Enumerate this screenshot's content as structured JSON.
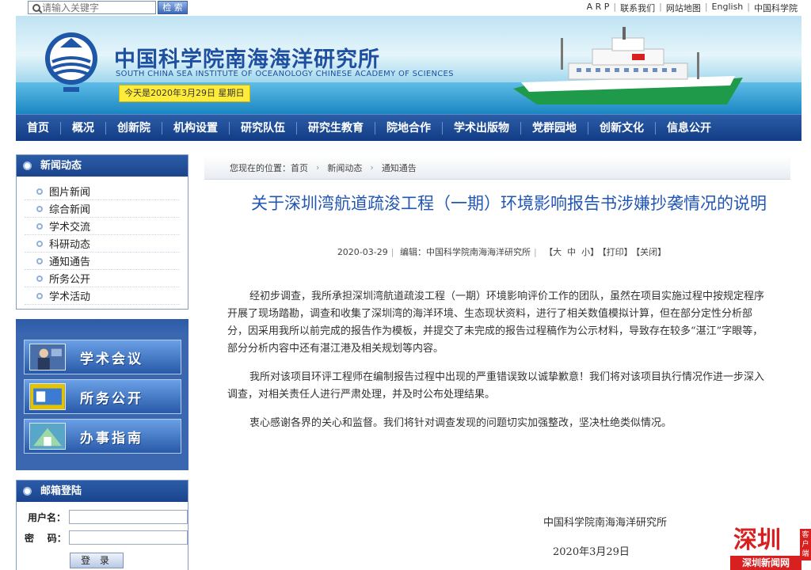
{
  "topbar": {
    "search_placeholder": "请输入关键字",
    "search_button": "检 索",
    "links": [
      "A R P",
      "联系我们",
      "网站地图",
      "English",
      "中国科学院"
    ]
  },
  "banner": {
    "title_cn": "中国科学院南海海洋研究所",
    "title_en": "SOUTH CHINA SEA INSTITUTE OF OCEANOLOGY  CHINESE ACADEMY OF SCIENCES",
    "date": "今天是2020年3月29日  星期日"
  },
  "nav": [
    "首页",
    "概况",
    "创新院",
    "机构设置",
    "研究队伍",
    "研究生教育",
    "院地合作",
    "学术出版物",
    "党群园地",
    "创新文化",
    "信息公开"
  ],
  "news": {
    "title": "新闻动态",
    "items": [
      "图片新闻",
      "综合新闻",
      "学术交流",
      "科研动态",
      "通知通告",
      "所务公开",
      "学术活动"
    ]
  },
  "quick": [
    "学术会议",
    "所务公开",
    "办事指南"
  ],
  "mail": {
    "title": "邮箱登陆",
    "user_label": "用户名：",
    "pass_label": "密    码：",
    "login": "登 录"
  },
  "breadcrumb": {
    "prefix": "您现在的位置：",
    "items": [
      "首页",
      "新闻动态",
      "通知通告"
    ]
  },
  "article": {
    "title": "关于深圳湾航道疏浚工程（一期）环境影响报告书涉嫌抄袭情况的说明",
    "date": "2020-03-29",
    "editor": "编辑：中国科学院南海海洋研究所",
    "font_options": "【大  中  小】",
    "print": "【打印】",
    "close": "【关闭】",
    "paragraphs": [
      "经初步调查，我所承担深圳湾航道疏浚工程（一期）环境影响评价工作的团队，虽然在项目实施过程中按规定程序开展了现场踏勘，调查和收集了深圳湾的海洋环境、生态现状资料，进行了相关数值模拟计算，但在部分定性分析部分，因采用我所以前完成的报告作为模板，并提交了未完成的报告过程稿作为公示材料，导致存在较多“湛江”字眼等，部分分析内容中还有湛江港及相关规划等内容。",
      "我所对该项目环评工程师在编制报告过程中出现的严重错误致以诚挚歉意！我们将对该项目执行情况作进一步深入调查，对相关责任人进行严肃处理，并及时公布处理结果。",
      "衷心感谢各界的关心和监督。我们将针对调查发现的问题切实加强整改，坚决杜绝类似情况。"
    ],
    "signature": "中国科学院南海海洋研究所",
    "sign_date": "2020年3月29日"
  },
  "watermark": {
    "main": "深圳",
    "tag": "客户端",
    "sub": "深圳新闻网"
  }
}
